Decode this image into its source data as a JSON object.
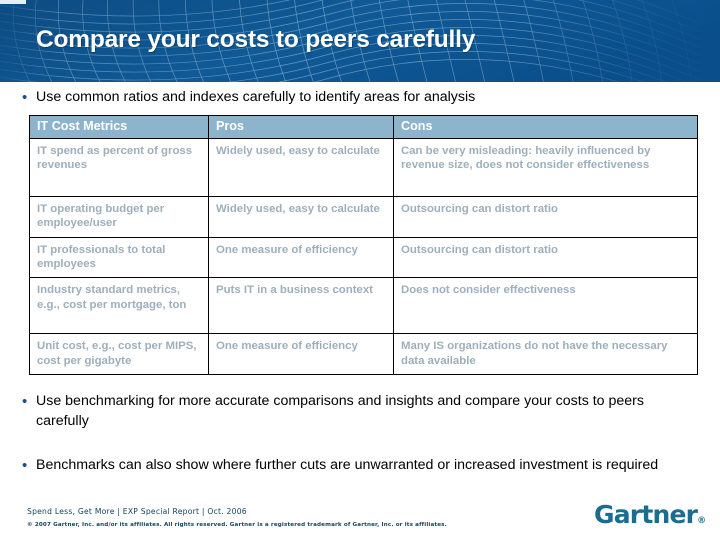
{
  "header": {
    "title": "Compare your costs to peers carefully",
    "background_color": "#0b5390",
    "mesh_color": "#ffffff",
    "title_color": "#ffffff"
  },
  "bullets": {
    "top": {
      "marker": "•",
      "text": "Use common ratios and indexes carefully to identify areas for analysis"
    },
    "middle": {
      "marker": "•",
      "text": "Use benchmarking for more accurate comparisons and insights and compare your costs to peers carefully"
    },
    "bottom": {
      "marker": "•",
      "text": "Benchmarks can also show where further cuts are unwarranted or increased investment is required"
    }
  },
  "table": {
    "header_bg": "#8cb4cd",
    "header_text_color": "#ffffff",
    "cell_text_color": "#9dafbd",
    "columns": [
      "IT Cost Metrics",
      "Pros",
      "Cons"
    ],
    "rows": [
      {
        "metric": "IT spend as percent of gross revenues",
        "pros": "Widely used, easy to calculate",
        "cons": "Can be very misleading: heavily influenced by revenue size, does not consider effectiveness"
      },
      {
        "metric": "IT operating budget per employee/user",
        "pros": "Widely used, easy to calculate",
        "cons": "Outsourcing can distort ratio"
      },
      {
        "metric": "IT professionals to total employees",
        "pros": "One measure of efficiency",
        "cons": "Outsourcing can distort ratio"
      },
      {
        "metric": "Industry standard metrics, e.g., cost per mortgage, ton",
        "pros": "Puts IT in a business context",
        "cons": "Does not consider effectiveness"
      },
      {
        "metric": "Unit cost, e.g., cost per MIPS, cost per gigabyte",
        "pros": "One measure of efficiency",
        "cons": "Many IS organizations do not have the necessary data available"
      }
    ]
  },
  "footer": {
    "source": "Spend Less, Get More | EXP Special Report | Oct. 2006",
    "copyright": "© 2007 Gartner, Inc. and/or its affiliates. All rights reserved. Gartner is a registered trademark of Gartner, Inc. or its affiliates.",
    "logo_text": "Gartner",
    "logo_tm": "®",
    "logo_color": "#1a6d8f",
    "text_color": "#14445e"
  }
}
